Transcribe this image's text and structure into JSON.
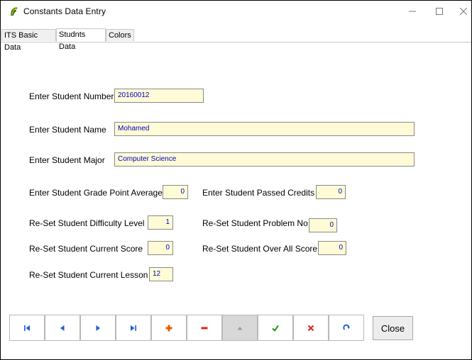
{
  "window": {
    "title": "Constants Data Entry"
  },
  "tabs": [
    {
      "label": "ITS Basic Data"
    },
    {
      "label": "Studnts Data"
    },
    {
      "label": "Colors"
    }
  ],
  "form": {
    "student_number": {
      "label": "Enter Student Number",
      "value": "20160012"
    },
    "student_name": {
      "label": "Enter Student Name",
      "value": "Mohamed"
    },
    "student_major": {
      "label": "Enter Student Major",
      "value": "Computer Science"
    },
    "gpa": {
      "label": "Enter Student Grade Point Average",
      "value": "0"
    },
    "passed_credits": {
      "label": "Enter Student Passed Credits",
      "value": "0"
    },
    "difficulty_level": {
      "label": "Re-Set Student Difficulty Level",
      "value": "1"
    },
    "problem_no": {
      "label": "Re-Set Student Problem No",
      "value": "0"
    },
    "current_score": {
      "label": "Re-Set Student Current Score",
      "value": "0"
    },
    "overall_score": {
      "label": "Re-Set Student Over All Score",
      "value": "0"
    },
    "current_lesson": {
      "label": "Re-Set Student Current Lesson",
      "value": "12"
    }
  },
  "navigator": {
    "buttons": [
      {
        "icon": "first-record-icon",
        "color": "#1a5fd0"
      },
      {
        "icon": "prior-record-icon",
        "color": "#1a5fd0"
      },
      {
        "icon": "next-record-icon",
        "color": "#1a5fd0"
      },
      {
        "icon": "last-record-icon",
        "color": "#1a5fd0"
      },
      {
        "icon": "insert-plus-icon",
        "color": "#e06000"
      },
      {
        "icon": "delete-minus-icon",
        "color": "#e02020"
      },
      {
        "icon": "edit-up-icon",
        "color": "#9a9a9a"
      },
      {
        "icon": "post-check-icon",
        "color": "#10a010"
      },
      {
        "icon": "cancel-x-icon",
        "color": "#e02020"
      },
      {
        "icon": "refresh-icon",
        "color": "#1a5fd0"
      }
    ]
  },
  "close_label": "Close"
}
